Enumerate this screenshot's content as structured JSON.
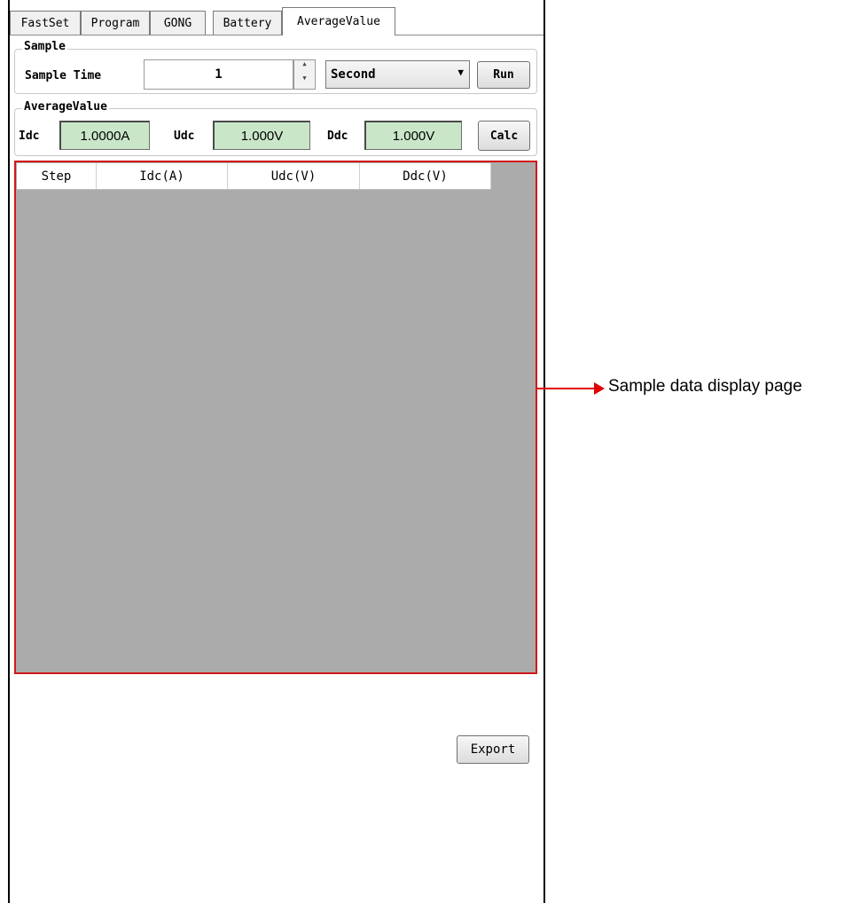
{
  "tabs": [
    {
      "label": "FastSet",
      "active": false
    },
    {
      "label": "Program",
      "active": false
    },
    {
      "label": "GONG",
      "active": false
    },
    {
      "label": "Battery",
      "active": false
    },
    {
      "label": "AverageValue",
      "active": true
    }
  ],
  "sample": {
    "group_label": "Sample",
    "time_label": "Sample Time",
    "time_value": "1",
    "unit_selected": "Second",
    "run_label": "Run"
  },
  "average": {
    "group_label": "AverageValue",
    "idc_label": "Idc",
    "idc_value": "1.0000A",
    "udc_label": "Udc",
    "udc_value": "1.000V",
    "ddc_label": "Ddc",
    "ddc_value": "1.000V",
    "calc_label": "Calc",
    "value_bg_color": "#c9e6c9"
  },
  "table": {
    "columns": [
      "Step",
      "Idc(A)",
      "Udc(V)",
      "Ddc(V)"
    ],
    "rows": []
  },
  "export_label": "Export",
  "annotation": {
    "text": "Sample data display page",
    "color": "#e00000"
  },
  "icons": {
    "spin": "spin-up-down-icon",
    "dropdown": "chevron-down-icon",
    "arrow": "arrow-right-icon"
  }
}
